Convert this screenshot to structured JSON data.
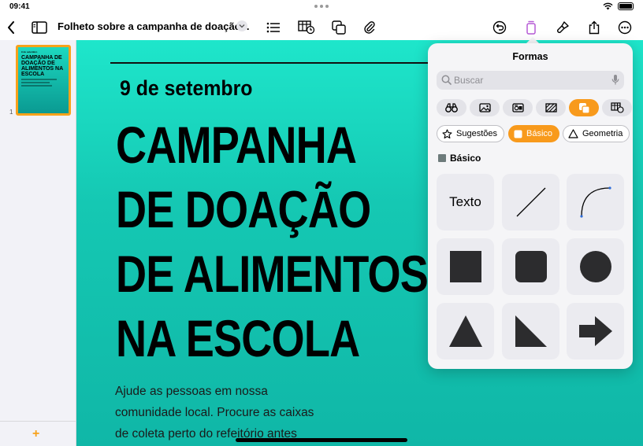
{
  "status": {
    "time": "09:41"
  },
  "toolbar": {
    "doc_title": "Folheto sobre a campanha de doação...",
    "icons": [
      "back-icon",
      "sidebar-icon",
      "chevron-down-icon",
      "list-icon",
      "table-icon",
      "shapes-icon",
      "paperclip-icon",
      "undo-icon",
      "format-icon",
      "brush-icon",
      "share-icon",
      "more-icon"
    ]
  },
  "sidebar": {
    "page_number": "1",
    "thumbnail": {
      "date": "9 de setembro",
      "title": "CAMPANHA DE DOAÇÃO DE ALIMENTOS NA ESCOLA"
    }
  },
  "canvas": {
    "date": "9 de setembro",
    "headline": [
      "CAMPANHA",
      "DE DOAÇÃO",
      "DE ALIMENTOS",
      "NA ESCOLA"
    ],
    "body_lines": [
      "Ajude as pessoas em nossa",
      "comunidade local. Procure as caixas",
      "de coleta perto do refeitório antes"
    ],
    "background_colors": [
      "#1ee6cb",
      "#10b7a7"
    ]
  },
  "shapes_panel": {
    "title": "Formas",
    "search_placeholder": "Buscar",
    "categories": [
      "binoculars-icon",
      "image-icon",
      "media-icon",
      "texture-icon",
      "shapes-icon",
      "table-icon"
    ],
    "active_category": 4,
    "chips": [
      {
        "label": "Sugestões",
        "icon": "star-icon"
      },
      {
        "label": "Básico",
        "icon": "square-icon"
      },
      {
        "label": "Geometria",
        "icon": "triangle-icon"
      }
    ],
    "active_chip": 1,
    "section_label": "Básico",
    "tiles": [
      "Texto",
      "line",
      "curve",
      "square",
      "rounded-square",
      "circle",
      "triangle",
      "right-triangle",
      "arrow"
    ],
    "accent_color": "#f89a1c"
  }
}
